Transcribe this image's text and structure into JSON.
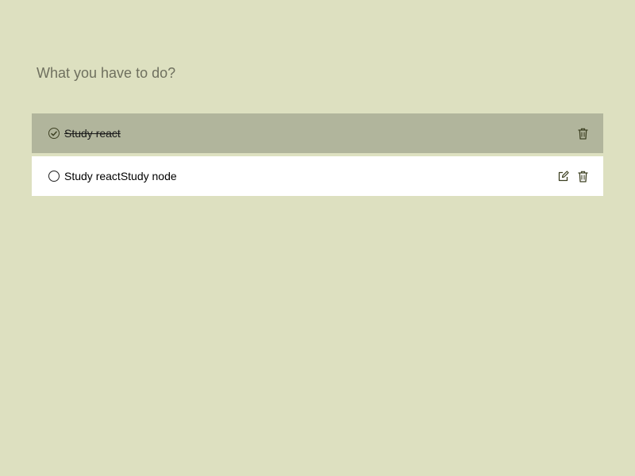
{
  "new_todo": {
    "placeholder": "What you have to do?",
    "value": ""
  },
  "todos": [
    {
      "label": "Study react",
      "completed": true,
      "icons": [
        "check-circle-icon",
        "trash-icon"
      ]
    },
    {
      "label": "Study reactStudy node",
      "completed": false,
      "icons": [
        "edit-icon",
        "trash-icon"
      ]
    }
  ],
  "colors": {
    "background": "#dde0c0",
    "completed_row": "#b1b59c",
    "active_row": "#ffffff",
    "icon": "#3d4022",
    "placeholder": "#6f705f"
  }
}
